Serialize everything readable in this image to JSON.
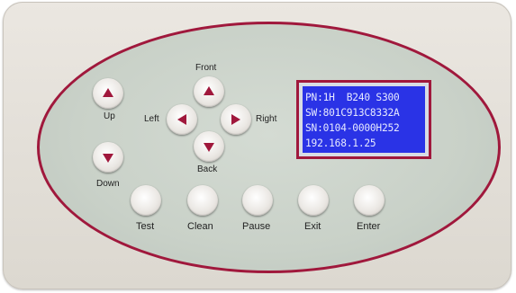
{
  "panel": {
    "accent_color": "#a0183c",
    "lcd_color": "#2a33e6"
  },
  "lcd": {
    "lines": [
      "PN:1H  B240 S300",
      "SW:801C913C8332A",
      "SN:0104-0000H252",
      "192.168.1.25"
    ]
  },
  "buttons": {
    "up": {
      "label": "Up",
      "icon": "triangle-up-icon"
    },
    "down": {
      "label": "Down",
      "icon": "triangle-down-icon"
    },
    "front": {
      "label": "Front",
      "icon": "triangle-up-icon"
    },
    "back": {
      "label": "Back",
      "icon": "triangle-down-icon"
    },
    "left": {
      "label": "Left",
      "icon": "triangle-left-icon"
    },
    "right": {
      "label": "Right",
      "icon": "triangle-right-icon"
    },
    "test": {
      "label": "Test"
    },
    "clean": {
      "label": "Clean"
    },
    "pause": {
      "label": "Pause"
    },
    "exit": {
      "label": "Exit"
    },
    "enter": {
      "label": "Enter"
    }
  }
}
